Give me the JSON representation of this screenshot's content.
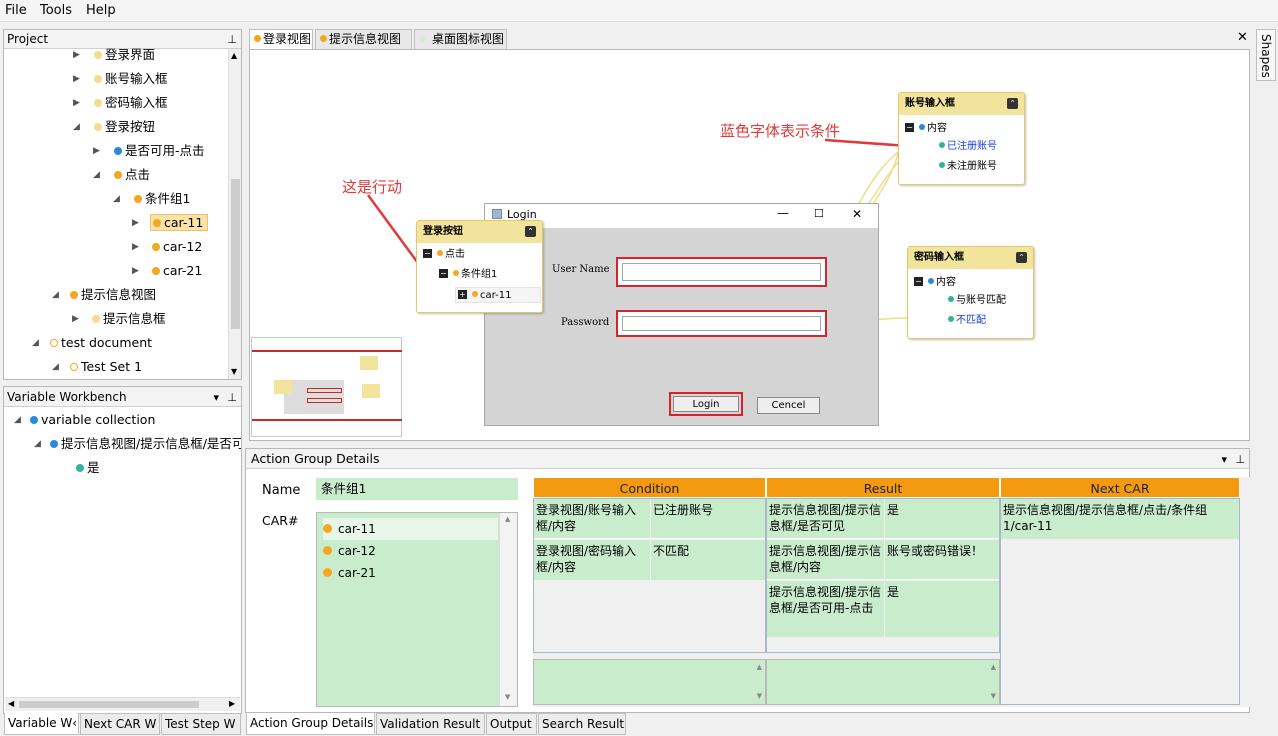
{
  "menu": [
    "File",
    "Tools",
    "Help"
  ],
  "project_panel": {
    "title": "Project",
    "tree": [
      {
        "label": "登录界面",
        "dot": "light"
      },
      {
        "label": "账号输入框",
        "dot": "light"
      },
      {
        "label": "密码输入框",
        "dot": "light"
      },
      {
        "label": "登录按钮",
        "dot": "light"
      },
      {
        "label": "是否可用-点击",
        "dot": "blue"
      },
      {
        "label": "点击",
        "dot": "or"
      },
      {
        "label": "条件组1",
        "dot": "or"
      },
      {
        "label": "car-11",
        "dot": "or"
      },
      {
        "label": "car-12",
        "dot": "or"
      },
      {
        "label": "car-21",
        "dot": "or"
      },
      {
        "label": "提示信息视图",
        "dot": "or"
      },
      {
        "label": "提示信息框",
        "dot": "light"
      },
      {
        "label": "test document",
        "dot": "ring"
      },
      {
        "label": "Test Set 1",
        "dot": "ring"
      }
    ]
  },
  "workbench": {
    "title": "Variable Workbench",
    "tree": [
      {
        "label": "variable collection"
      },
      {
        "label": "提示信息视图/提示信息框/是否可"
      },
      {
        "label": "是"
      }
    ]
  },
  "left_bottom_tabs": [
    "Variable W‹",
    "Next CAR W",
    "Test Step W"
  ],
  "editor_tabs": [
    "登录视图",
    "提示信息视图",
    "桌面图标视图"
  ],
  "shapes_label": "Shapes",
  "canvas": {
    "annotation_action": "这是行动",
    "annotation_condition": "蓝色字体表示条件",
    "login_window": {
      "title": "Login",
      "min": "—",
      "max": "☐",
      "close": "✕",
      "username_label": "User Name",
      "password_label": "Password",
      "login_btn": "Login",
      "cancel_btn": "Cencel"
    },
    "node_login_btn": {
      "title": "登录按钮",
      "row1": "点击",
      "row2": "条件组1",
      "row3": "car-11"
    },
    "node_account": {
      "title": "账号输入框",
      "row1": "内容",
      "row2": "已注册账号",
      "row3": "未注册账号"
    },
    "node_password": {
      "title": "密码输入框",
      "row1": "内容",
      "row2": "与账号匹配",
      "row3": "不匹配"
    }
  },
  "details": {
    "title": "Action Group Details",
    "name_label": "Name",
    "name_value": "条件组1",
    "car_label": "CAR#",
    "cars": [
      "car-11",
      "car-12",
      "car-21"
    ],
    "headers": {
      "condition": "Condition",
      "result": "Result",
      "next": "Next CAR"
    },
    "condition_rows": [
      {
        "k": "登录视图/账号输入框/内容",
        "v": "已注册账号"
      },
      {
        "k": "登录视图/密码输入框/内容",
        "v": "不匹配"
      }
    ],
    "result_rows": [
      {
        "k": "提示信息视图/提示信息框/是否可见",
        "v": "是"
      },
      {
        "k": "提示信息视图/提示信息框/内容",
        "v": "账号或密码错误！"
      },
      {
        "k": "提示信息视图/提示信息框/是否可用-点击",
        "v": "是"
      }
    ],
    "next_car": "提示信息视图/提示信息框/点击/条件组1/car-11"
  },
  "bottom_tabs": [
    "Action Group Details",
    "Validation Result",
    "Output",
    "Search Result"
  ],
  "colors": {
    "accent": "#f49a10",
    "green": "#c8eccc",
    "annot": "#e03a3a"
  }
}
